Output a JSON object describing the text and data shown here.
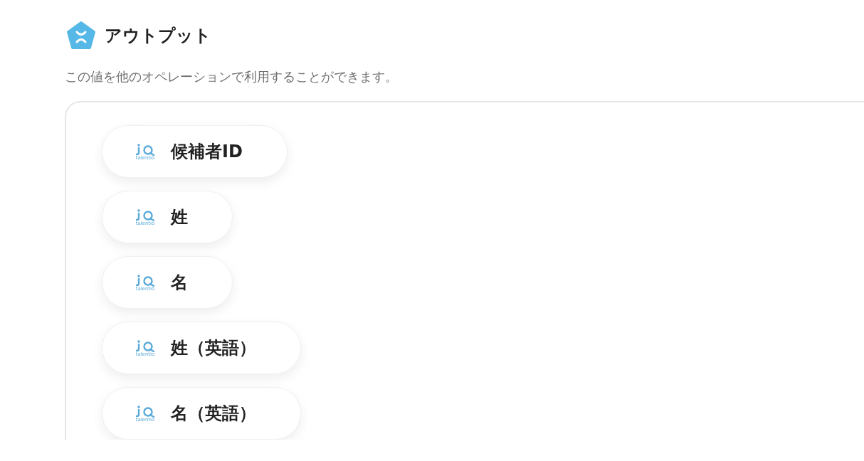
{
  "header": {
    "title": "アウトプット",
    "description": "この値を他のオペレーションで利用することができます。"
  },
  "outputs": [
    {
      "label": "候補者ID",
      "source": "talentio"
    },
    {
      "label": "姓",
      "source": "talentio"
    },
    {
      "label": "名",
      "source": "talentio"
    },
    {
      "label": "姓（英語）",
      "source": "talentio"
    },
    {
      "label": "名（英語）",
      "source": "talentio"
    }
  ]
}
